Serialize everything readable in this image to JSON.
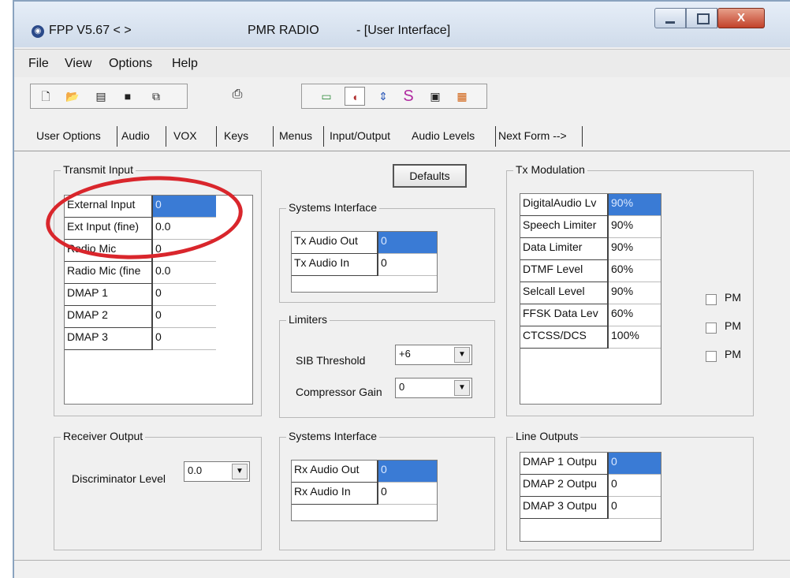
{
  "window": {
    "app_name": "FPP V5.67  < >",
    "product": "PMR RADIO",
    "form": "- [User Interface]",
    "close_glyph": "X"
  },
  "menu": [
    "File",
    "View",
    "Options",
    "Help"
  ],
  "toolbar": {
    "file_icons": [
      "new-file-icon",
      "open-folder-icon",
      "import-icon",
      "save-icon",
      "copy-icon"
    ],
    "print_icon": "printer-icon",
    "radio_icons": [
      "battery-icon",
      "audio-speaker-icon",
      "up-down-arrows-icon",
      "signal-s-icon",
      "display-icon",
      "tone-icon"
    ]
  },
  "tabs": [
    "User Options",
    "Audio",
    "VOX",
    "Keys",
    "Menus",
    "Input/Output",
    "Audio Levels",
    "Next Form -->"
  ],
  "transmit_input": {
    "title": "Transmit Input",
    "rows": [
      {
        "label": "External Input",
        "value": "0"
      },
      {
        "label": "Ext Input (fine)",
        "value": "0.0"
      },
      {
        "label": "Radio Mic",
        "value": "0"
      },
      {
        "label": "Radio Mic (fine",
        "value": "0.0"
      },
      {
        "label": "DMAP 1",
        "value": "0"
      },
      {
        "label": "DMAP 2",
        "value": "0"
      },
      {
        "label": "DMAP 3",
        "value": "0"
      }
    ]
  },
  "defaults_button": "Defaults",
  "systems_interface_tx": {
    "title": "Systems Interface",
    "rows": [
      {
        "label": "Tx Audio Out",
        "value": "0"
      },
      {
        "label": "Tx Audio In",
        "value": "0"
      }
    ]
  },
  "limiters": {
    "title": "Limiters",
    "sib_label": "SIB Threshold",
    "sib_value": "+6",
    "comp_label": "Compressor Gain",
    "comp_value": "0"
  },
  "tx_modulation": {
    "title": "Tx Modulation",
    "rows": [
      {
        "label": "DigitalAudio Lv",
        "value": "90%"
      },
      {
        "label": "Speech Limiter",
        "value": "90%"
      },
      {
        "label": "Data Limiter",
        "value": "90%"
      },
      {
        "label": "DTMF Level",
        "value": "60%"
      },
      {
        "label": "Selcall Level",
        "value": "90%"
      },
      {
        "label": "FFSK Data Lev",
        "value": "60%"
      },
      {
        "label": "CTCSS/DCS",
        "value": "100%"
      }
    ],
    "pm_label": "PM"
  },
  "receiver_output": {
    "title": "Receiver Output",
    "disc_label": "Discriminator Level",
    "disc_value": "0.0"
  },
  "systems_interface_rx": {
    "title": "Systems Interface",
    "rows": [
      {
        "label": "Rx Audio Out",
        "value": "0"
      },
      {
        "label": "Rx Audio In",
        "value": "0"
      }
    ]
  },
  "line_outputs": {
    "title": "Line Outputs",
    "rows": [
      {
        "label": "DMAP 1 Outpu",
        "value": "0"
      },
      {
        "label": "DMAP 2 Outpu",
        "value": "0"
      },
      {
        "label": "DMAP 3 Outpu",
        "value": "0"
      }
    ]
  },
  "colors": {
    "selection": "#3a7bd5",
    "annotation": "#d9262c"
  }
}
